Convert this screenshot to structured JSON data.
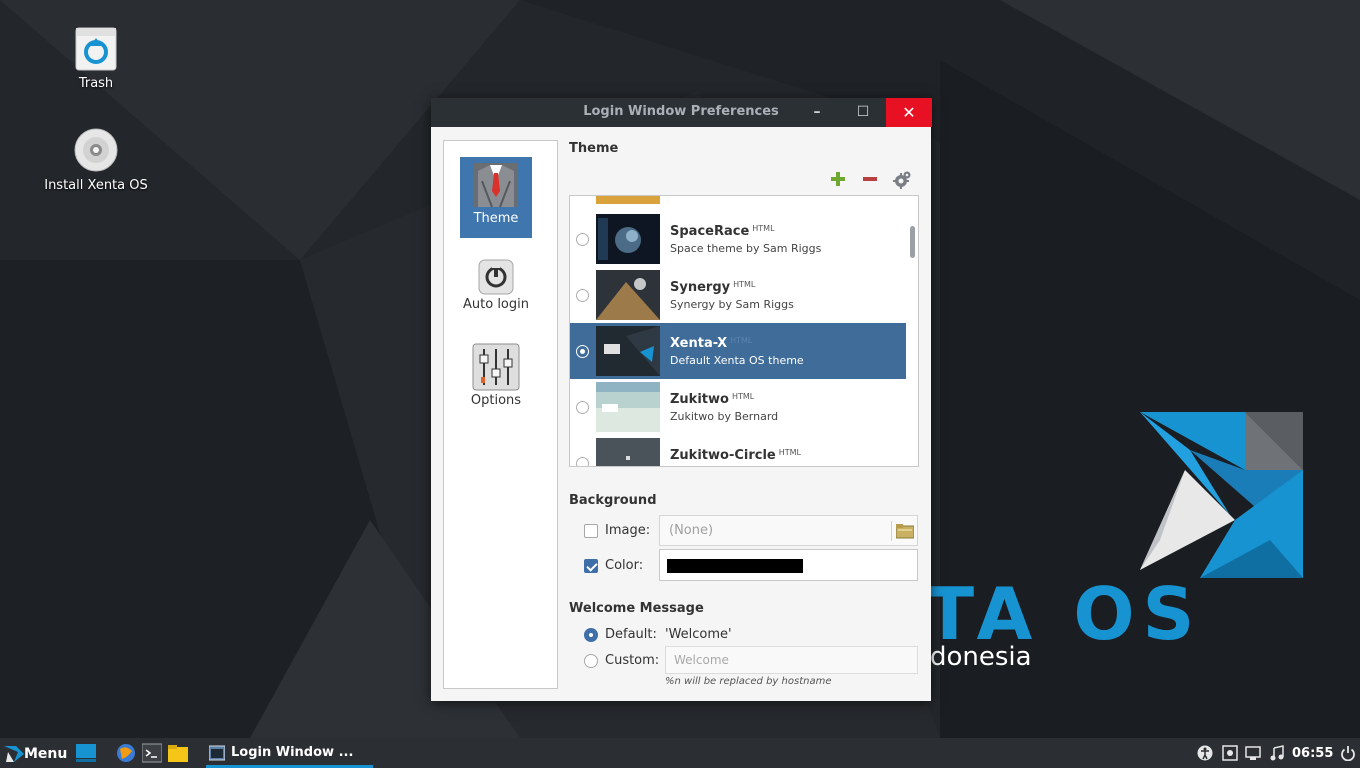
{
  "desktop": {
    "icons": [
      {
        "label": "Trash"
      },
      {
        "label": "Install Xenta OS"
      }
    ],
    "wallpaper": {
      "brand_letters": "TA OS",
      "brand_sub": "donesia",
      "accent_color": "#1793d1"
    }
  },
  "window": {
    "title": "Login Window Preferences",
    "controls": {
      "minimize": "–",
      "maximize": "☐",
      "close": "✕"
    },
    "sidebar": {
      "items": [
        {
          "label": "Theme",
          "icon": "suit-icon",
          "active": true
        },
        {
          "label": "Auto login",
          "icon": "power-icon",
          "active": false
        },
        {
          "label": "Options",
          "icon": "sliders-icon",
          "active": false
        }
      ]
    },
    "theme_section": {
      "title": "Theme",
      "toolbar": {
        "add": "add-theme",
        "remove": "remove-theme",
        "settings": "theme-settings"
      },
      "themes": [
        {
          "name": "SpaceRace",
          "tag": "HTML",
          "description": "Space theme by Sam Riggs",
          "selected": false
        },
        {
          "name": "Synergy",
          "tag": "HTML",
          "description": "Synergy by Sam Riggs",
          "selected": false
        },
        {
          "name": "Xenta-X",
          "tag": "HTML",
          "description": "Default Xenta OS theme",
          "selected": true
        },
        {
          "name": "Zukitwo",
          "tag": "HTML",
          "description": "Zukitwo by Bernard",
          "selected": false
        },
        {
          "name": "Zukitwo-Circle",
          "tag": "HTML",
          "description": "",
          "selected": false
        }
      ]
    },
    "background_section": {
      "title": "Background",
      "image_label": "Image:",
      "image_checked": false,
      "image_value": "(None)",
      "color_label": "Color:",
      "color_checked": true,
      "color_value": "#000000"
    },
    "welcome_section": {
      "title": "Welcome Message",
      "default_label": "Default:",
      "default_value": "'Welcome'",
      "default_selected": true,
      "custom_label": "Custom:",
      "custom_placeholder": "Welcome",
      "hint": "%n will be replaced by hostname"
    }
  },
  "taskbar": {
    "menu_label": "Menu",
    "task_label": "Login Window ...",
    "clock": "06:55"
  }
}
